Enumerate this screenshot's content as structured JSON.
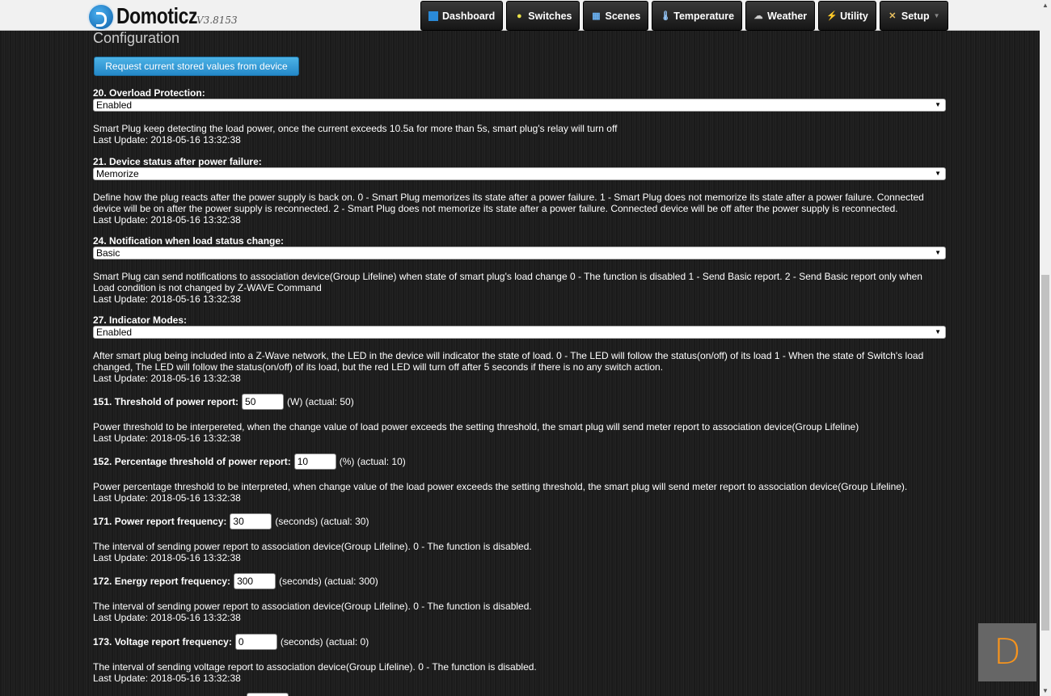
{
  "header": {
    "brand": "Domoticz",
    "version": "V3.8153",
    "nav": [
      {
        "label": "Dashboard",
        "icon": "dashboard-icon"
      },
      {
        "label": "Switches",
        "icon": "bulb-icon"
      },
      {
        "label": "Scenes",
        "icon": "scenes-icon"
      },
      {
        "label": "Temperature",
        "icon": "thermometer-icon"
      },
      {
        "label": "Weather",
        "icon": "weather-icon"
      },
      {
        "label": "Utility",
        "icon": "utility-icon"
      },
      {
        "label": "Setup",
        "icon": "tools-icon"
      }
    ]
  },
  "page": {
    "title": "Configuration",
    "request_button": "Request current stored values from device"
  },
  "params": [
    {
      "label": "20. Overload Protection:",
      "value": "Enabled",
      "desc": "Smart Plug keep detecting the load power, once the current exceeds 10.5a for more than 5s, smart plug's relay will turn off",
      "last": "Last Update: 2018-05-16 13:32:38"
    },
    {
      "label": "21. Device status after power failure:",
      "value": "Memorize",
      "desc": "Define how the plug reacts after the power supply is back on. 0 - Smart Plug memorizes its state after a power failure. 1 - Smart Plug does not memorize its state after a power failure. Connected device will be on after the power supply is reconnected. 2 - Smart Plug does not memorize its state after a power failure. Connected device will be off after the power supply is reconnected.",
      "last": "Last Update: 2018-05-16 13:32:38"
    },
    {
      "label": "24. Notification when load status change:",
      "value": "Basic",
      "desc": "Smart Plug can send notifications to association device(Group Lifeline) when state of smart plug's load change 0 - The function is disabled 1 - Send Basic report. 2 - Send Basic report only when Load condition is not changed by Z-WAVE Command",
      "last": "Last Update: 2018-05-16 13:32:38"
    },
    {
      "label": "27. Indicator Modes:",
      "value": "Enabled",
      "desc": "After smart plug being included into a Z-Wave network, the LED in the device will indicator the state of load. 0 - The LED will follow the status(on/off) of its load 1 - When the state of Switch's load changed, The LED will follow the status(on/off) of its load, but the red LED will turn off after 5 seconds if there is no any switch action.",
      "last": "Last Update: 2018-05-16 13:32:38"
    },
    {
      "label": "151. Threshold of power report:",
      "value": "50",
      "unit": "(W) (actual: 50)",
      "desc": "Power threshold to be interpereted, when the change value of load power exceeds the setting threshold, the smart plug will send meter report to association device(Group Lifeline)",
      "last": "Last Update: 2018-05-16 13:32:38"
    },
    {
      "label": "152. Percentage threshold of power report:",
      "value": "10",
      "unit": "(%) (actual: 10)",
      "desc": "Power percentage threshold to be interpreted, when change value of the load power exceeds the setting threshold, the smart plug will send meter report to association device(Group Lifeline).",
      "last": "Last Update: 2018-05-16 13:32:38"
    },
    {
      "label": "171. Power report frequency:",
      "value": "30",
      "unit": "(seconds) (actual: 30)",
      "desc": "The interval of sending power report to association device(Group Lifeline). 0 - The function is disabled.",
      "last": "Last Update: 2018-05-16 13:32:38"
    },
    {
      "label": "172. Energy report frequency:",
      "value": "300",
      "unit": "(seconds) (actual: 300)",
      "desc": "The interval of sending power report to association device(Group Lifeline). 0 - The function is disabled.",
      "last": "Last Update: 2018-05-16 13:32:38"
    },
    {
      "label": "173. Voltage report frequency:",
      "value": "0",
      "unit": "(seconds) (actual: 0)",
      "desc": "The interval of sending voltage report to association device(Group Lifeline). 0 - The function is disabled.",
      "last": "Last Update: 2018-05-16 13:32:38"
    }
  ],
  "badge": "D",
  "colors": {
    "accent": "#2e94d4",
    "badge": "#f7941d"
  }
}
